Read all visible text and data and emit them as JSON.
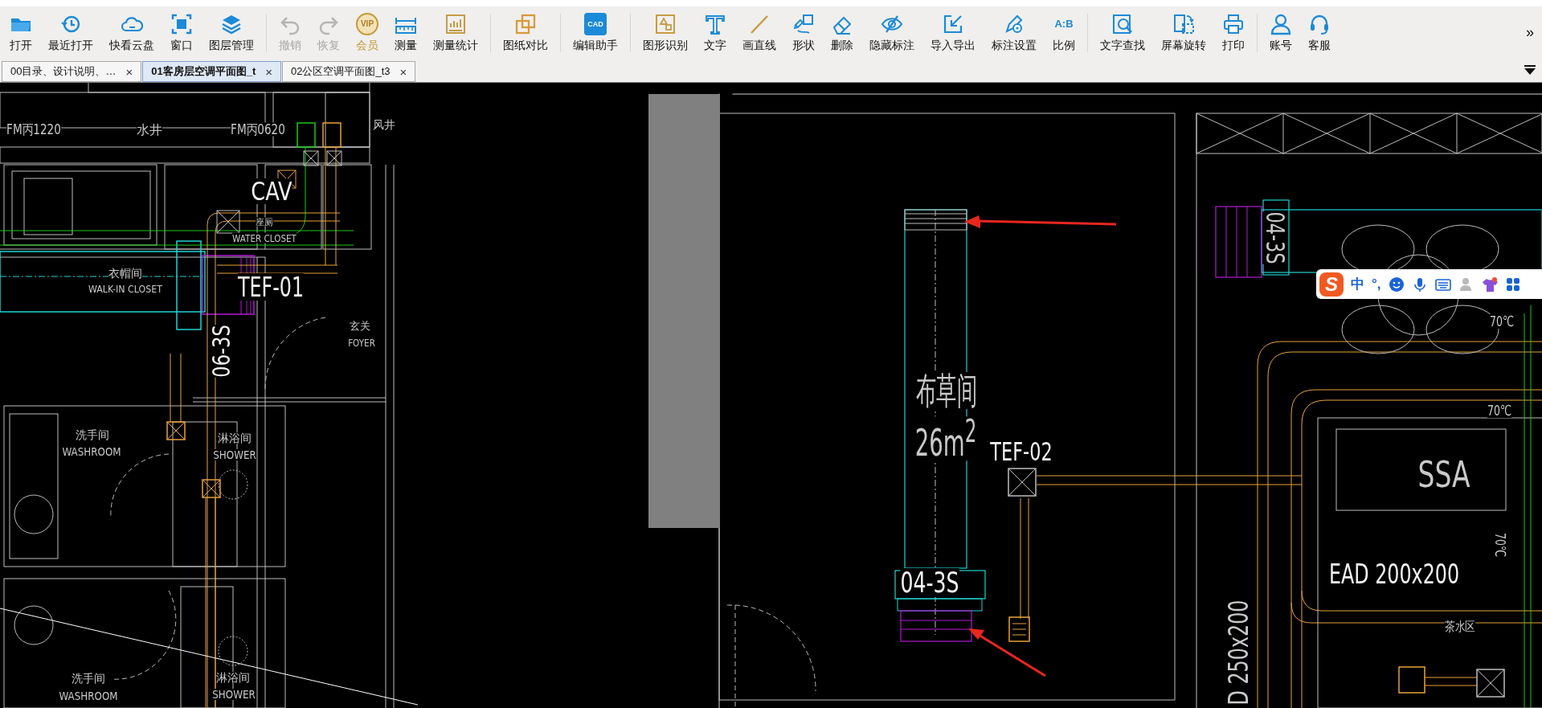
{
  "toolbar": {
    "groups": [
      [
        {
          "label": "打开",
          "kind": "plain",
          "disabled": false
        },
        {
          "label": "最近打开",
          "kind": "plain",
          "disabled": false
        },
        {
          "label": "快看云盘",
          "kind": "plain",
          "disabled": false
        },
        {
          "label": "窗口",
          "kind": "plain",
          "disabled": false
        },
        {
          "label": "图层管理",
          "kind": "plain",
          "disabled": false
        }
      ],
      [
        {
          "label": "撤销",
          "kind": "plain",
          "disabled": true
        },
        {
          "label": "恢复",
          "kind": "plain",
          "disabled": true
        },
        {
          "label": "会员",
          "badge": "VIP",
          "kind": "vip",
          "disabled": false
        },
        {
          "label": "测量",
          "kind": "plain",
          "disabled": false
        },
        {
          "label": "测量统计",
          "kind": "plain",
          "disabled": false
        }
      ],
      [
        {
          "label": "图纸对比",
          "kind": "plain",
          "disabled": false
        }
      ],
      [
        {
          "label": "编辑助手",
          "badge": "CAD",
          "kind": "app",
          "disabled": false
        }
      ],
      [
        {
          "label": "图形识别",
          "kind": "plain",
          "disabled": false
        },
        {
          "label": "文字",
          "kind": "plain",
          "disabled": false
        },
        {
          "label": "画直线",
          "kind": "plain",
          "disabled": false
        },
        {
          "label": "形状",
          "kind": "plain",
          "disabled": false
        },
        {
          "label": "删除",
          "kind": "plain",
          "disabled": false
        },
        {
          "label": "隐藏标注",
          "kind": "plain",
          "disabled": false
        },
        {
          "label": "导入导出",
          "kind": "plain",
          "disabled": false
        },
        {
          "label": "标注设置",
          "kind": "plain",
          "disabled": false
        },
        {
          "label": "比例",
          "badge": "A:B",
          "kind": "plain",
          "disabled": false
        }
      ],
      [
        {
          "label": "文字查找",
          "kind": "plain",
          "disabled": false
        },
        {
          "label": "屏幕旋转",
          "kind": "plain",
          "disabled": false
        },
        {
          "label": "打印",
          "kind": "plain",
          "disabled": false
        }
      ],
      [
        {
          "label": "账号",
          "kind": "plain",
          "disabled": false
        },
        {
          "label": "客服",
          "kind": "plain",
          "disabled": false
        }
      ]
    ],
    "more": "»"
  },
  "tabs": [
    {
      "label": "00目录、设计说明、…",
      "close": "×",
      "selected": false
    },
    {
      "label": "01客房层空调平面图_t",
      "close": "×",
      "selected": true
    },
    {
      "label": "02公区空调平面图_t3",
      "close": "×",
      "selected": false
    }
  ],
  "drawing": {
    "labels": [
      {
        "text": "FM丙1220"
      },
      {
        "text": "水井"
      },
      {
        "text": "FM丙0620"
      },
      {
        "text": "风井"
      },
      {
        "text": "CAV"
      },
      {
        "text": "座厕"
      },
      {
        "text": "WATER CLOSET"
      },
      {
        "text": "衣帽间"
      },
      {
        "text": "WALK-IN CLOSET"
      },
      {
        "text": "TEF-01"
      },
      {
        "text": "06-3S"
      },
      {
        "text": "玄关"
      },
      {
        "text": "FOYER"
      },
      {
        "text": "洗手间"
      },
      {
        "text": "WASHROOM"
      },
      {
        "text": "淋浴间"
      },
      {
        "text": "SHOWER"
      },
      {
        "text": "洗手间"
      },
      {
        "text": "WASHROOM"
      },
      {
        "text": "淋浴间"
      },
      {
        "text": "SHOWER"
      },
      {
        "text": "布草间"
      },
      {
        "text": "26m$^{2}$"
      },
      {
        "text": "TEF-02"
      },
      {
        "text": "04-3S"
      },
      {
        "text": "SSA"
      },
      {
        "text": "EAD 200x200"
      },
      {
        "text": "茶水区"
      },
      {
        "text": "70℃"
      },
      {
        "text": "70℃"
      },
      {
        "text": "70℃"
      },
      {
        "text": "D 250x200"
      },
      {
        "text": "04-3S"
      }
    ]
  },
  "ime_bar": {
    "logo": "S",
    "mode": "中",
    "punctuation": "°,"
  }
}
